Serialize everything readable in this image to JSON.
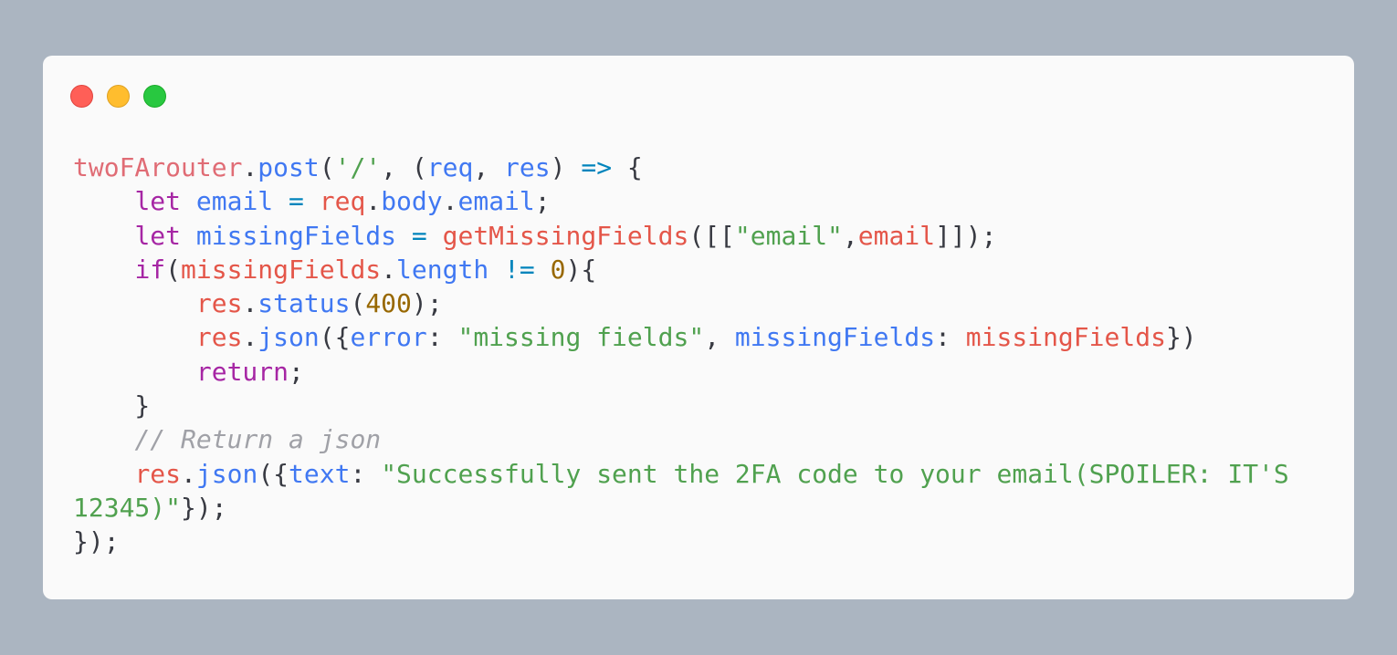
{
  "window": {
    "buttons": [
      {
        "name": "close",
        "color": "#ff5f57",
        "border": "#e0443e"
      },
      {
        "name": "minimize",
        "color": "#ffbd2e",
        "border": "#dea123"
      },
      {
        "name": "maximize",
        "color": "#28c840",
        "border": "#1aab29"
      }
    ]
  },
  "code": {
    "language": "javascript",
    "lines": [
      [
        {
          "t": "twoFArouter",
          "c": "var2"
        },
        {
          "t": ".",
          "c": "plain"
        },
        {
          "t": "post",
          "c": "fn"
        },
        {
          "t": "(",
          "c": "plain"
        },
        {
          "t": "'/'",
          "c": "str"
        },
        {
          "t": ", (",
          "c": "plain"
        },
        {
          "t": "req",
          "c": "fn"
        },
        {
          "t": ", ",
          "c": "plain"
        },
        {
          "t": "res",
          "c": "fn"
        },
        {
          "t": ") ",
          "c": "plain"
        },
        {
          "t": "=>",
          "c": "op"
        },
        {
          "t": " {",
          "c": "plain"
        }
      ],
      [
        {
          "t": "    ",
          "c": "plain"
        },
        {
          "t": "let",
          "c": "kw"
        },
        {
          "t": " ",
          "c": "plain"
        },
        {
          "t": "email",
          "c": "fn"
        },
        {
          "t": " ",
          "c": "plain"
        },
        {
          "t": "=",
          "c": "op"
        },
        {
          "t": " ",
          "c": "plain"
        },
        {
          "t": "req",
          "c": "var"
        },
        {
          "t": ".",
          "c": "plain"
        },
        {
          "t": "body",
          "c": "fn"
        },
        {
          "t": ".",
          "c": "plain"
        },
        {
          "t": "email",
          "c": "fn"
        },
        {
          "t": ";",
          "c": "plain"
        }
      ],
      [
        {
          "t": "    ",
          "c": "plain"
        },
        {
          "t": "let",
          "c": "kw"
        },
        {
          "t": " ",
          "c": "plain"
        },
        {
          "t": "missingFields",
          "c": "fn"
        },
        {
          "t": " ",
          "c": "plain"
        },
        {
          "t": "=",
          "c": "op"
        },
        {
          "t": " ",
          "c": "plain"
        },
        {
          "t": "getMissingFields",
          "c": "var"
        },
        {
          "t": "([[",
          "c": "plain"
        },
        {
          "t": "\"email\"",
          "c": "str"
        },
        {
          "t": ",",
          "c": "plain"
        },
        {
          "t": "email",
          "c": "var"
        },
        {
          "t": "]]);",
          "c": "plain"
        }
      ],
      [
        {
          "t": "    ",
          "c": "plain"
        },
        {
          "t": "if",
          "c": "kw"
        },
        {
          "t": "(",
          "c": "plain"
        },
        {
          "t": "missingFields",
          "c": "var"
        },
        {
          "t": ".",
          "c": "plain"
        },
        {
          "t": "length",
          "c": "fn"
        },
        {
          "t": " ",
          "c": "plain"
        },
        {
          "t": "!=",
          "c": "op"
        },
        {
          "t": " ",
          "c": "plain"
        },
        {
          "t": "0",
          "c": "num"
        },
        {
          "t": "){",
          "c": "plain"
        }
      ],
      [
        {
          "t": "        ",
          "c": "plain"
        },
        {
          "t": "res",
          "c": "var"
        },
        {
          "t": ".",
          "c": "plain"
        },
        {
          "t": "status",
          "c": "fn"
        },
        {
          "t": "(",
          "c": "plain"
        },
        {
          "t": "400",
          "c": "num"
        },
        {
          "t": ");",
          "c": "plain"
        }
      ],
      [
        {
          "t": "        ",
          "c": "plain"
        },
        {
          "t": "res",
          "c": "var"
        },
        {
          "t": ".",
          "c": "plain"
        },
        {
          "t": "json",
          "c": "fn"
        },
        {
          "t": "({",
          "c": "plain"
        },
        {
          "t": "error",
          "c": "fn"
        },
        {
          "t": ": ",
          "c": "plain"
        },
        {
          "t": "\"missing fields\"",
          "c": "str"
        },
        {
          "t": ", ",
          "c": "plain"
        },
        {
          "t": "missingFields",
          "c": "fn"
        },
        {
          "t": ": ",
          "c": "plain"
        },
        {
          "t": "missingFields",
          "c": "var"
        },
        {
          "t": "})",
          "c": "plain"
        }
      ],
      [
        {
          "t": "        ",
          "c": "plain"
        },
        {
          "t": "return",
          "c": "kw"
        },
        {
          "t": ";",
          "c": "plain"
        }
      ],
      [
        {
          "t": "    }",
          "c": "plain"
        }
      ],
      [
        {
          "t": "    ",
          "c": "plain"
        },
        {
          "t": "// Return a json",
          "c": "cm"
        }
      ],
      [
        {
          "t": "    ",
          "c": "plain"
        },
        {
          "t": "res",
          "c": "var"
        },
        {
          "t": ".",
          "c": "plain"
        },
        {
          "t": "json",
          "c": "fn"
        },
        {
          "t": "({",
          "c": "plain"
        },
        {
          "t": "text",
          "c": "fn"
        },
        {
          "t": ": ",
          "c": "plain"
        },
        {
          "t": "\"Successfully sent the 2FA code to your email(SPOILER: IT'S",
          "c": "str"
        }
      ],
      [
        {
          "t": "12345)\"",
          "c": "str"
        },
        {
          "t": "});",
          "c": "plain"
        }
      ],
      [
        {
          "t": "});",
          "c": "plain"
        }
      ]
    ]
  }
}
